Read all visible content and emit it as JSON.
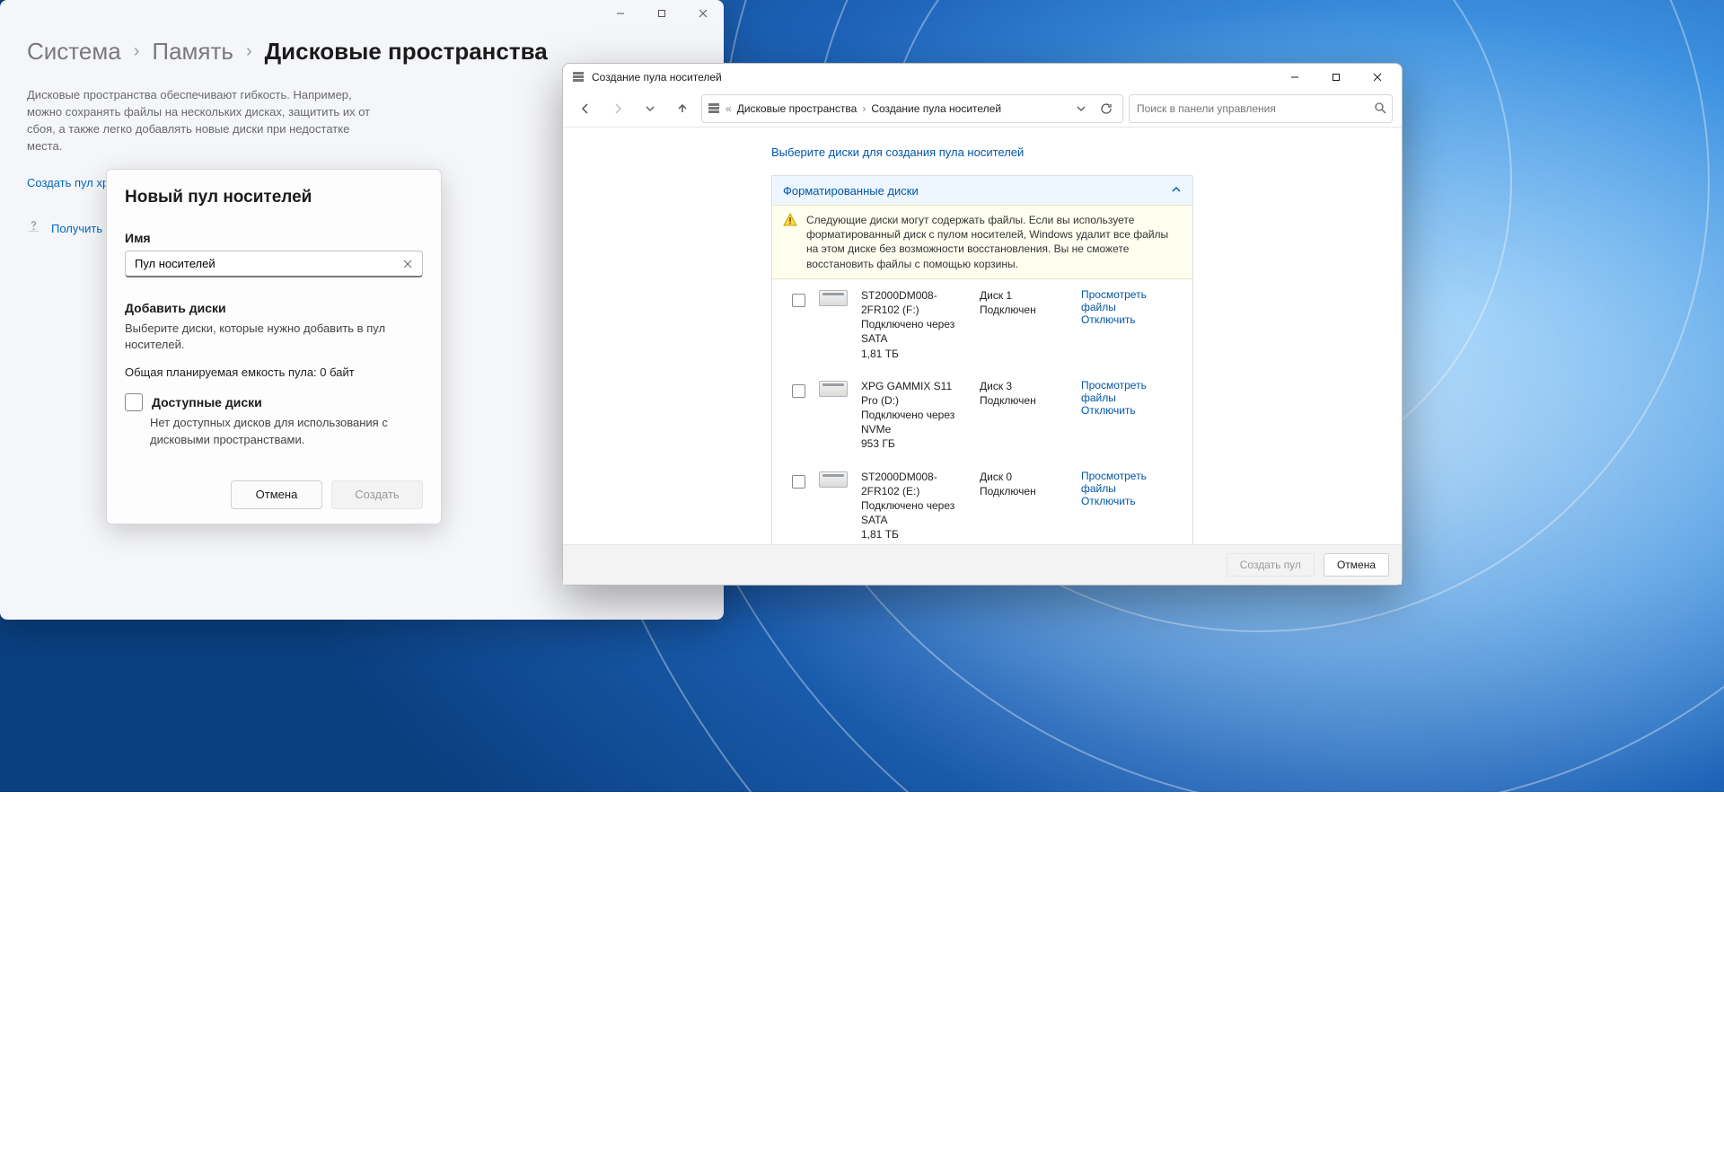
{
  "settings": {
    "breadcrumb": {
      "item1": "Система",
      "item2": "Память",
      "current": "Дисковые пространства"
    },
    "description": "Дисковые пространства обеспечивают гибкость. Например, можно сохранять файлы на нескольких дисках, защитить их от сбоя, а также легко добавлять новые диски при недостатке места.",
    "create_link": "Создать пул хранения и место для хранения",
    "help_link": "Получить помощь"
  },
  "pool_dialog": {
    "title": "Новый пул носителей",
    "name_label": "Имя",
    "name_value": "Пул носителей",
    "add_title": "Добавить диски",
    "add_hint": "Выберите диски, которые нужно добавить в пул носителей.",
    "total": "Общая планируемая емкость пула: 0 байт",
    "available_label": "Доступные диски",
    "available_msg": "Нет доступных дисков для использования с дисковыми пространствами.",
    "cancel": "Отмена",
    "create": "Создать"
  },
  "cp": {
    "title": "Создание пула носителей",
    "address": {
      "root": "Дисковые пространства",
      "current": "Создание пула носителей"
    },
    "search_placeholder": "Поиск в панели управления",
    "heading": "Выберите диски для создания пула носителей",
    "group_title": "Форматированные диски",
    "warning": "Следующие диски могут содержать файлы. Если вы используете форматированный диск с пулом носителей, Windows удалит все файлы на этом диске без возможности восстановления. Вы не сможете восстановить файлы с помощью корзины.",
    "view_files": "Просмотреть файлы",
    "disconnect": "Отключить",
    "disks": [
      {
        "name": "ST2000DM008-2FR102 (F:)",
        "conn": "Подключено через SATA",
        "size": "1,81 ТБ",
        "slot": "Диск 1",
        "status": "Подключен"
      },
      {
        "name": "XPG GAMMIX S11 Pro (D:)",
        "conn": "Подключено через NVMe",
        "size": "953 ГБ",
        "slot": "Диск 3",
        "status": "Подключен"
      },
      {
        "name": "ST2000DM008-2FR102 (E:)",
        "conn": "Подключено через SATA",
        "size": "1,81 ТБ",
        "slot": "Диск 0",
        "status": "Подключен"
      }
    ],
    "footer": {
      "create": "Создать пул",
      "cancel": "Отмена"
    }
  }
}
